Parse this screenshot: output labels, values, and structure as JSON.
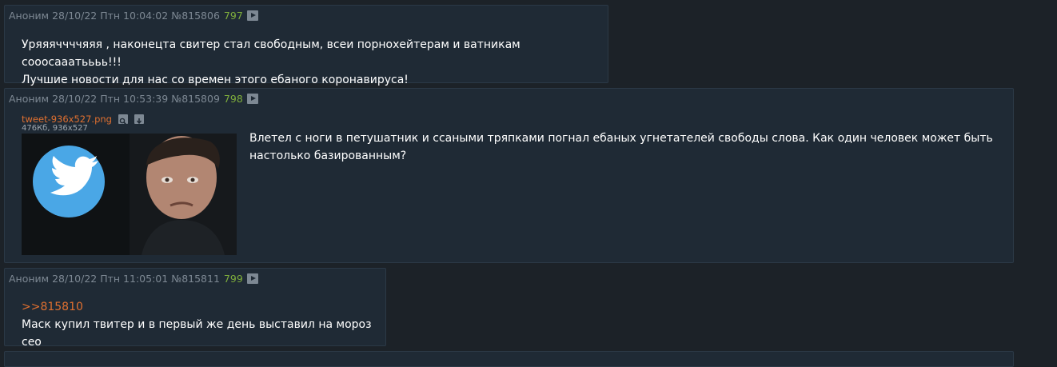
{
  "posts": [
    {
      "author": "Аноним",
      "date": "28/10/22 Птн 10:04:02",
      "number": "№815806",
      "count": "797",
      "lines": [
        "Уряяяччччяяя , наконецта свитер стал свободным, всеи порнохейтерам и ватникам сооосааатьььь!!!",
        "Лучшие новости для нас со времен этого ебаного коронавируса!"
      ]
    },
    {
      "author": "Аноним",
      "date": "28/10/22 Птн 10:53:39",
      "number": "№815809",
      "count": "798",
      "file": {
        "name": "tweet-936x527.png",
        "meta": "476Кб, 936x527"
      },
      "lines": [
        "Влетел с ноги в петушатник и ссаными тряпками погнал ебаных угнетателей свободы слова. Как один человек может быть",
        "настолько базированным?"
      ]
    },
    {
      "author": "Аноним",
      "date": "28/10/22 Птн 11:05:01",
      "number": "№815811",
      "count": "799",
      "reply_to": ">>815810",
      "lines": [
        "Маск купил твитер и в первый же день выставил на мороз сео"
      ]
    }
  ],
  "colors": {
    "background": "#1c2228",
    "post_bg": "#1f2a35",
    "link": "#e07030",
    "count": "#7fae3c",
    "meta": "#7d8893"
  }
}
